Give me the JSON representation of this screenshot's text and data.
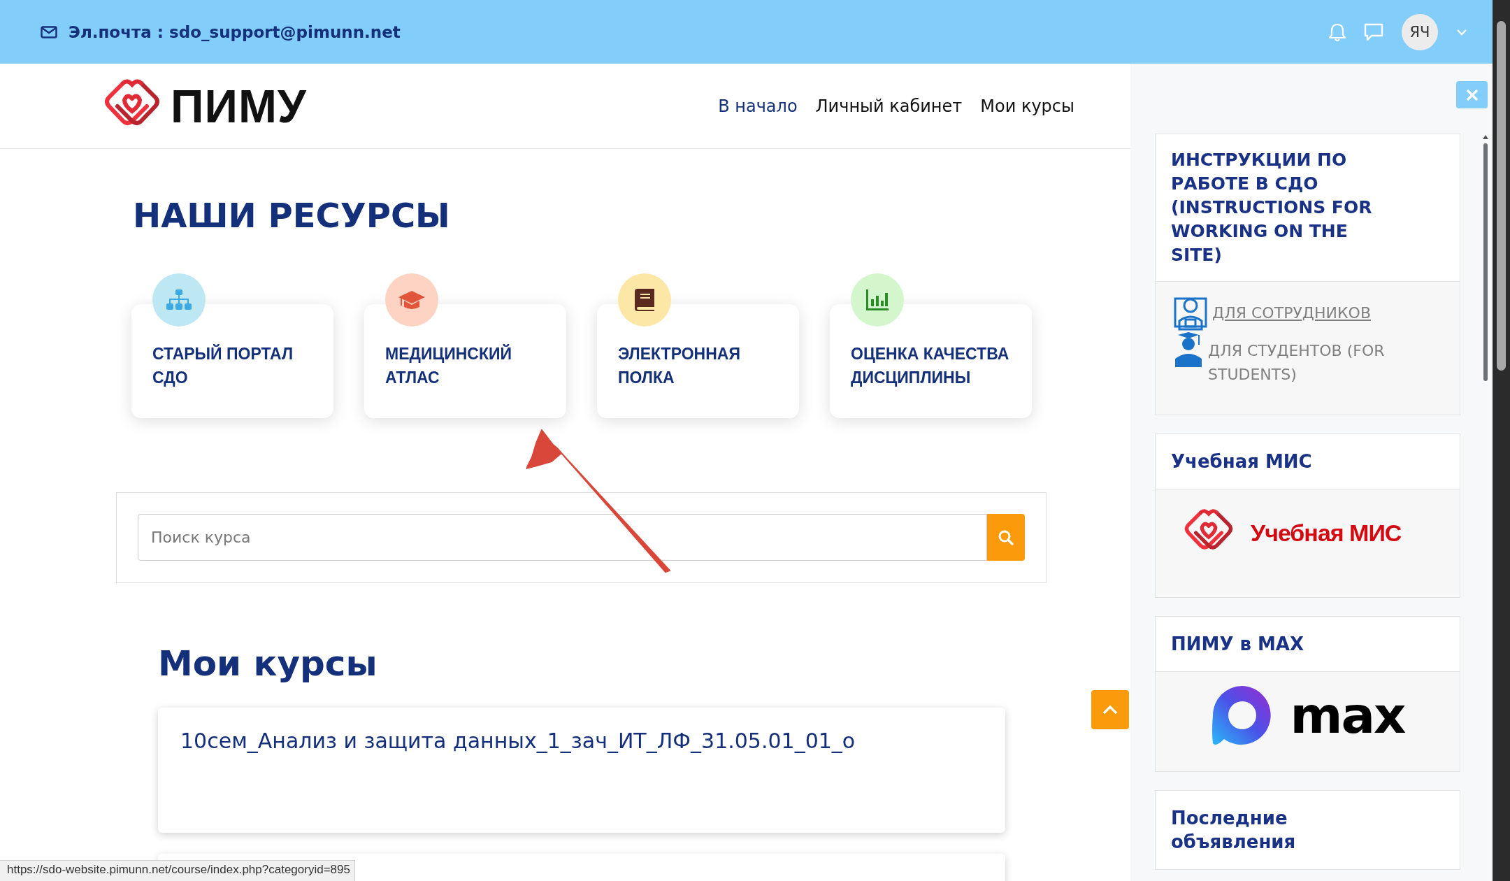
{
  "top_bar": {
    "email_label": "Эл.почта : sdo_support@pimunn.net",
    "avatar_initials": "ЯЧ"
  },
  "header": {
    "logo_text": "ПИМУ",
    "nav": [
      {
        "label": "В начало",
        "selected": true
      },
      {
        "label": "Личный кабинет",
        "selected": false
      },
      {
        "label": "Мои курсы",
        "selected": false
      }
    ]
  },
  "resources": {
    "title": "НАШИ РЕСУРСЫ",
    "cards": [
      {
        "title": "СТАРЫЙ ПОРТАЛ СДО",
        "kind": "sitemap",
        "color": "#bde8f3"
      },
      {
        "title": "МЕДИЦИНСКИЙ АТЛАС",
        "kind": "cap",
        "color": "#fdd3c3"
      },
      {
        "title": "ЭЛЕКТРОННАЯ ПОЛКА",
        "kind": "book",
        "color": "#fde7a7"
      },
      {
        "title": "ОЦЕНКА КАЧЕСТВА ДИСЦИПЛИНЫ",
        "kind": "chart",
        "color": "#d4f6cd"
      }
    ]
  },
  "search": {
    "placeholder": "Поиск курса"
  },
  "my_courses": {
    "title": "Мои курсы",
    "courses": [
      {
        "name": "10сем_Анализ и защита данных_1_зач_ИТ_ЛФ_31.05.01_01_о"
      }
    ]
  },
  "status_url": "https://sdo-website.pimunn.net/course/index.php?categoryid=895",
  "drawer": {
    "blocks": [
      {
        "kind": "links",
        "title": "ИНСТРУКЦИИ ПО РАБОТЕ В СДО (INSTRUCTIONS FOR WORKING ON THE SITE)",
        "links": [
          {
            "label": "ДЛЯ СОТРУДНИКОВ",
            "kind": "staff",
            "underlined": true
          },
          {
            "label": "ДЛЯ СТУДЕНТОВ (FOR STUDENTS)",
            "kind": "student",
            "underlined": false
          }
        ]
      },
      {
        "kind": "mis",
        "title": "Учебная МИС",
        "logo_text": "Учебная МИС"
      },
      {
        "kind": "max",
        "title": "ПИМУ в MAX",
        "logo_text": "max"
      },
      {
        "kind": "text",
        "title": "Последние объявления"
      }
    ]
  }
}
